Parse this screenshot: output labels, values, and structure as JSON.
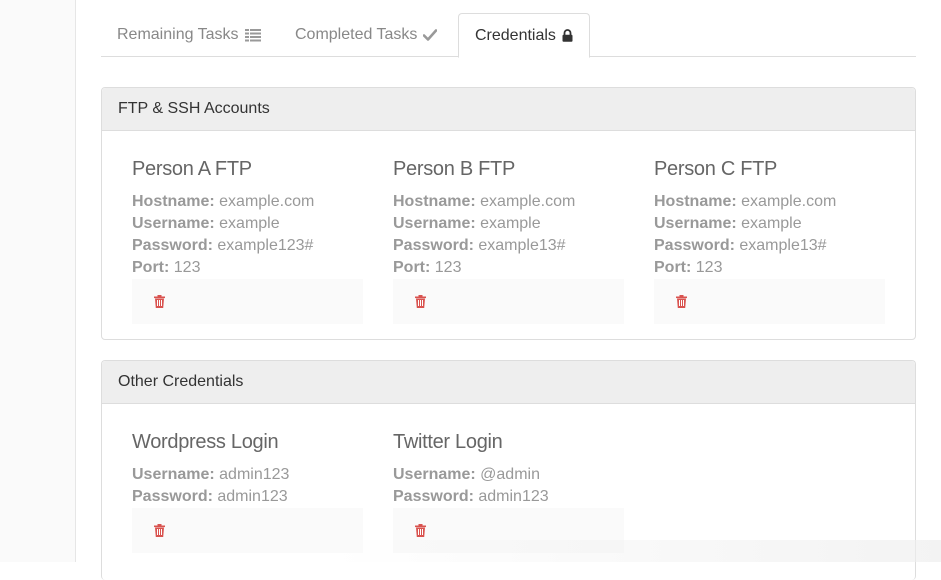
{
  "tabs": [
    {
      "label": "Remaining Tasks",
      "icon": "list-icon",
      "active": false
    },
    {
      "label": "Completed Tasks",
      "icon": "check-icon",
      "active": false
    },
    {
      "label": "Credentials",
      "icon": "lock-icon",
      "active": true
    }
  ],
  "panels": [
    {
      "title": "FTP & SSH Accounts",
      "items": [
        {
          "title": "Person A FTP",
          "fields": [
            {
              "label": "Hostname:",
              "value": "example.com"
            },
            {
              "label": "Username:",
              "value": "example"
            },
            {
              "label": "Password:",
              "value": "example123#"
            },
            {
              "label": "Port:",
              "value": "123"
            }
          ]
        },
        {
          "title": "Person B FTP",
          "fields": [
            {
              "label": "Hostname:",
              "value": "example.com"
            },
            {
              "label": "Username:",
              "value": "example"
            },
            {
              "label": "Password:",
              "value": "example13#"
            },
            {
              "label": "Port:",
              "value": "123"
            }
          ]
        },
        {
          "title": "Person C FTP",
          "fields": [
            {
              "label": "Hostname:",
              "value": "example.com"
            },
            {
              "label": "Username:",
              "value": "example"
            },
            {
              "label": "Password:",
              "value": "example13#"
            },
            {
              "label": "Port:",
              "value": "123"
            }
          ]
        }
      ]
    },
    {
      "title": "Other Credentials",
      "items": [
        {
          "title": "Wordpress Login",
          "fields": [
            {
              "label": "Username:",
              "value": "admin123"
            },
            {
              "label": "Password:",
              "value": "admin123"
            }
          ]
        },
        {
          "title": "Twitter Login",
          "fields": [
            {
              "label": "Username:",
              "value": "@admin"
            },
            {
              "label": "Password:",
              "value": "admin123"
            }
          ]
        }
      ]
    }
  ],
  "colors": {
    "trash": "#d9534f",
    "panel_heading_bg": "#eeeeee",
    "action_bar_bg": "#fafafa"
  }
}
